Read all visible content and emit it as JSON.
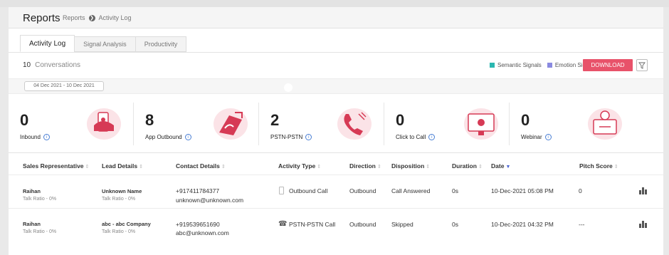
{
  "header": {
    "title": "Reports",
    "breadcrumb": [
      "Reports",
      "Activity Log"
    ]
  },
  "tabs": [
    {
      "label": "Activity Log",
      "active": true
    },
    {
      "label": "Signal Analysis",
      "active": false
    },
    {
      "label": "Productivity",
      "active": false
    }
  ],
  "summary": {
    "count": "10",
    "label": "Conversations"
  },
  "legend": [
    {
      "label": "Semantic Signals",
      "color": "#2bb7b0"
    },
    {
      "label": "Emotion Signals",
      "color": "#8a8ae0"
    }
  ],
  "download_label": "DOWNLOAD",
  "date_range": "04 Dec 2021 - 10 Dec 2021",
  "stats": [
    {
      "value": "0",
      "label": "Inbound",
      "icon": "inbound-illustration-icon"
    },
    {
      "value": "8",
      "label": "App Outbound",
      "icon": "app-outbound-illustration-icon"
    },
    {
      "value": "2",
      "label": "PSTN-PSTN",
      "icon": "pstn-illustration-icon"
    },
    {
      "value": "0",
      "label": "Click to Call",
      "icon": "click-to-call-illustration-icon"
    },
    {
      "value": "0",
      "label": "Webinar",
      "icon": "webinar-illustration-icon"
    }
  ],
  "table": {
    "columns": [
      "Sales Representative",
      "Lead Details",
      "Contact Details",
      "Activity Type",
      "Direction",
      "Disposition",
      "Duration",
      "Date",
      "Pitch Score"
    ],
    "rows": [
      {
        "rep": "Raihan",
        "rep_sub": "Talk Ratio - 0%",
        "lead": "Unknown Name",
        "lead_sub": "Talk Ratio - 0%",
        "phone": "+917411784377",
        "email": "unknown@unknown.com",
        "activity": "Outbound Call",
        "activity_icon": "mobile-phone-icon",
        "direction": "Outbound",
        "disposition": "Call Answered",
        "duration": "0s",
        "date": "10-Dec-2021 05:08 PM",
        "pitch": "0"
      },
      {
        "rep": "Raihan",
        "rep_sub": "Talk Ratio - 0%",
        "lead": "abc - abc Company",
        "lead_sub": "Talk Ratio - 0%",
        "phone": "+919539651690",
        "email": "abc@unknown.com",
        "activity": "PSTN-PSTN Call",
        "activity_icon": "telephone-icon",
        "direction": "Outbound",
        "disposition": "Skipped",
        "duration": "0s",
        "date": "10-Dec-2021 04:32 PM",
        "pitch": "---"
      }
    ]
  }
}
